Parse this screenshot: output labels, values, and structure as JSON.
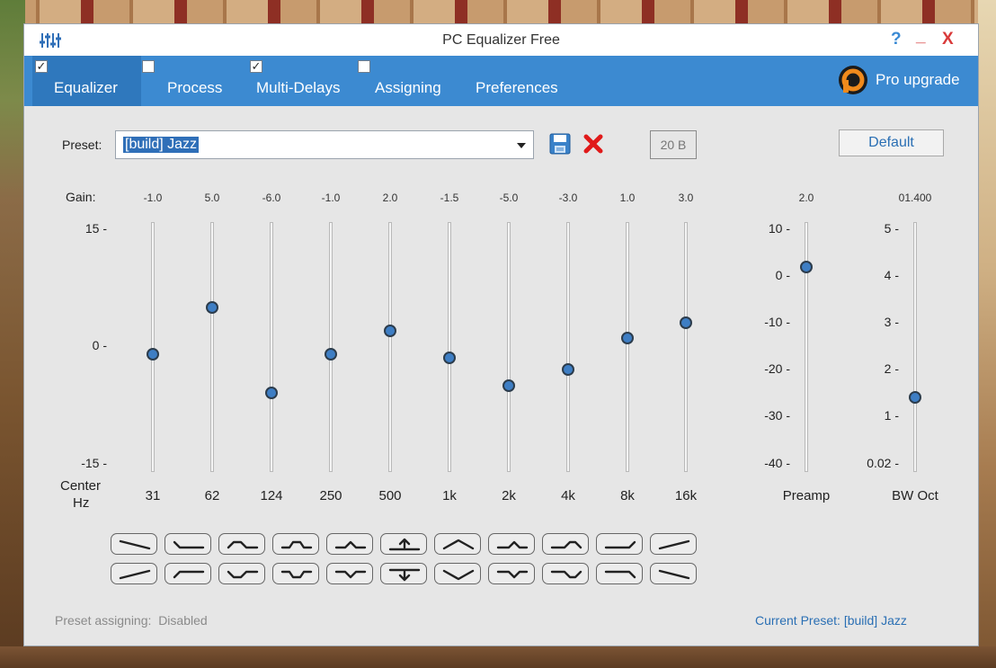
{
  "window": {
    "title": "PC Equalizer Free",
    "help_label": "?",
    "minimize_label": "_",
    "close_label": "X"
  },
  "tabs": [
    {
      "label": "Equalizer",
      "checkbox": true,
      "checked": true,
      "active": true
    },
    {
      "label": "Process",
      "checkbox": true,
      "checked": false,
      "active": false
    },
    {
      "label": "Multi-Delays",
      "checkbox": true,
      "checked": true,
      "active": false
    },
    {
      "label": "Assigning",
      "checkbox": true,
      "checked": false,
      "active": false
    },
    {
      "label": "Preferences",
      "checkbox": false,
      "checked": false,
      "active": false
    }
  ],
  "pro_upgrade": {
    "label": "Pro upgrade",
    "icon": "pro-logo-icon"
  },
  "preset": {
    "label": "Preset:",
    "value": "[build] Jazz",
    "save_icon": "save-icon",
    "delete_icon": "delete-x-icon",
    "band_count": "20 B",
    "default_label": "Default"
  },
  "gain_label": "Gain:",
  "gain_axis": [
    "15 -",
    "0 -",
    "-15 -"
  ],
  "center_label": "Center",
  "hz_label": "Hz",
  "bands": [
    {
      "freq": "31",
      "gain_text": "-1.0",
      "gain": -1.0
    },
    {
      "freq": "62",
      "gain_text": "5.0",
      "gain": 5.0
    },
    {
      "freq": "124",
      "gain_text": "-6.0",
      "gain": -6.0
    },
    {
      "freq": "250",
      "gain_text": "-1.0",
      "gain": -1.0
    },
    {
      "freq": "500",
      "gain_text": "2.0",
      "gain": 2.0
    },
    {
      "freq": "1k",
      "gain_text": "-1.5",
      "gain": -1.5
    },
    {
      "freq": "2k",
      "gain_text": "-5.0",
      "gain": -5.0
    },
    {
      "freq": "4k",
      "gain_text": "-3.0",
      "gain": -3.0
    },
    {
      "freq": "8k",
      "gain_text": "1.0",
      "gain": 1.0
    },
    {
      "freq": "16k",
      "gain_text": "3.0",
      "gain": 3.0
    }
  ],
  "preamp": {
    "label": "Preamp",
    "value_text": "2.0",
    "value": 2.0,
    "axis": [
      "10 -",
      "0 -",
      "-10 -",
      "-20 -",
      "-30 -",
      "-40 -"
    ]
  },
  "bw_oct": {
    "label": "BW Oct",
    "value_text": "01.400",
    "value": 1.4,
    "axis": [
      "5 -",
      "4 -",
      "3 -",
      "2 -",
      "1 -",
      "0.02 -"
    ]
  },
  "shape_buttons_top": [
    "tilt-down",
    "low-shelf-cut",
    "bump-low",
    "bump-lowmid",
    "bump-mid",
    "raise-all",
    "bump-wide",
    "bump-highmid",
    "bump-high",
    "high-shelf-boost",
    "tilt-up"
  ],
  "shape_buttons_bottom": [
    "tilt-up",
    "low-shelf-boost",
    "dip-low",
    "dip-lowmid",
    "dip-mid",
    "lower-all",
    "dip-wide",
    "dip-highmid",
    "dip-high",
    "high-shelf-cut",
    "tilt-down"
  ],
  "status": {
    "assigning_label": "Preset assigning:",
    "assigning_value": "Disabled",
    "current_label": "Current Preset:",
    "current_value": "[build] Jazz"
  }
}
